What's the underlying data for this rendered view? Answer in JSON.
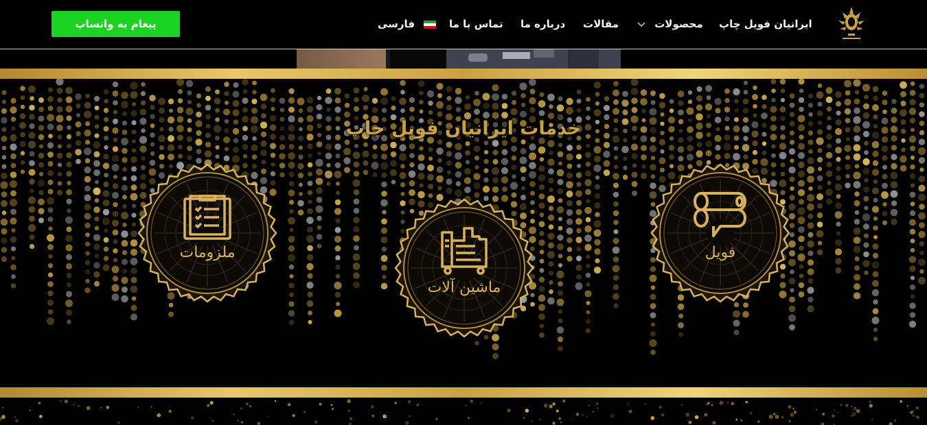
{
  "header": {
    "brand": "ایرانیان فویل چاپ",
    "nav": {
      "products": "محصولات",
      "articles": "مقالات",
      "about": "درباره ما",
      "contact": "تماس با ما",
      "language": "فارسی"
    },
    "whatsapp_button": "پیغام به واتساپ"
  },
  "services": {
    "title": "خدمات ایرانیان فویل چاپ",
    "items": [
      {
        "label": "فویل",
        "icon": "foil-roll-icon"
      },
      {
        "label": "ماشین آلات",
        "icon": "machine-icon"
      },
      {
        "label": "ملزومات",
        "icon": "clipboard-checklist-icon"
      }
    ]
  },
  "colors": {
    "gold": "#c9a243",
    "whatsapp_green": "#1ad322",
    "background": "#000000"
  }
}
